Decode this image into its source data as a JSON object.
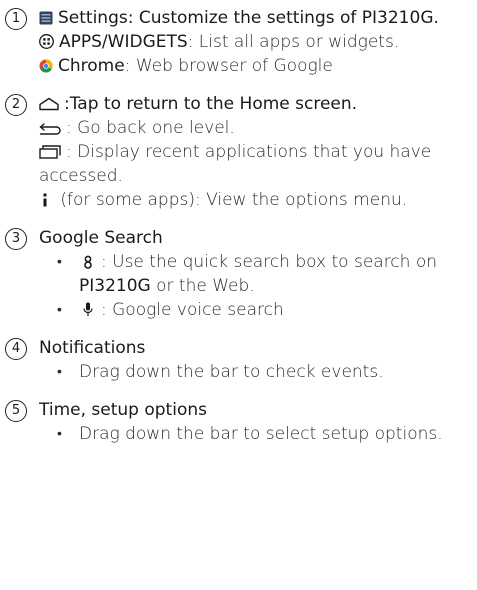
{
  "sections": [
    {
      "number": "1",
      "settings": {
        "title": "Settings: Customize the settings of PI3210G.",
        "icon": "settings-app-icon"
      },
      "apps": {
        "label": "APPS/WIDGETS",
        "desc": ": List all apps or widgets.",
        "icon": "apps-grid-icon"
      },
      "chrome": {
        "label": "Chrome",
        "desc": ": Web browser of Google",
        "icon": "chrome-icon"
      }
    },
    {
      "number": "2",
      "home": {
        "text": ":Tap to return to the Home screen.",
        "icon": "home-icon"
      },
      "back": {
        "text": ": Go back one level.",
        "icon": "back-arrow-icon"
      },
      "recent": {
        "text": ": Display recent applications that you have accessed.",
        "icon": "recent-apps-icon"
      },
      "options": {
        "text": " (for some apps): View the options menu.",
        "icon": "menu-dots-icon"
      }
    },
    {
      "number": "3",
      "title": "Google Search",
      "items": [
        {
          "icon": "quick-search-icon",
          "text_a": ": Use the quick search box to search on ",
          "bold": "PI3210G",
          "text_b": " or the Web."
        },
        {
          "icon": "microphone-icon",
          "text_a": ": Google voice search"
        }
      ]
    },
    {
      "number": "4",
      "title": "Notifications",
      "items": [
        {
          "text": "Drag down the bar to check events."
        }
      ]
    },
    {
      "number": "5",
      "title": "Time, setup options",
      "items": [
        {
          "text": "Drag down the bar to select setup options."
        }
      ]
    }
  ]
}
